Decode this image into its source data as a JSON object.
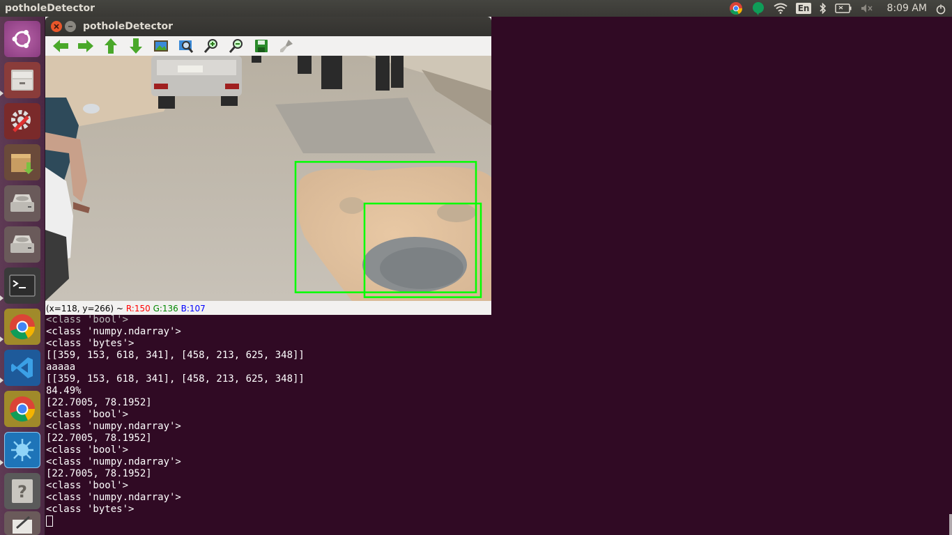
{
  "top_panel": {
    "app_name": "potholeDetector",
    "keyboard_layout": "En",
    "clock": "8:09 AM"
  },
  "window": {
    "title": "potholeDetector",
    "status": {
      "coords": "(x=118, y=266) ~",
      "r": "R:150",
      "g": "G:136",
      "b": "B:107"
    }
  },
  "toolbar_icons": [
    "arrow-left-icon",
    "arrow-right-icon",
    "arrow-up-icon",
    "arrow-down-icon",
    "image-icon",
    "zoom-fit-icon",
    "zoom-in-icon",
    "zoom-out-icon",
    "save-icon",
    "brush-icon"
  ],
  "launcher_icons": [
    "ubuntu-dash-icon",
    "file-manager-icon",
    "system-settings-icon",
    "software-updater-icon",
    "disk-drive-icon",
    "disk-drive-icon",
    "terminal-icon",
    "chrome-icon",
    "vscode-icon",
    "chrome-icon",
    "spyder-icon",
    "help-icon",
    "text-editor-icon"
  ],
  "detections": [
    [
      359,
      153,
      618,
      341
    ],
    [
      458,
      213,
      625,
      348
    ]
  ],
  "terminal": {
    "lines": [
      "<class 'bool'>",
      "<class 'numpy.ndarray'>",
      "<class 'bytes'>",
      "[[359, 153, 618, 341], [458, 213, 625, 348]]",
      "aaaaa",
      "[[359, 153, 618, 341], [458, 213, 625, 348]]",
      "84.49%",
      "[22.7005, 78.1952]",
      "<class 'bool'>",
      "<class 'numpy.ndarray'>",
      "[22.7005, 78.1952]",
      "<class 'bool'>",
      "<class 'numpy.ndarray'>",
      "[22.7005, 78.1952]",
      "<class 'bool'>",
      "<class 'numpy.ndarray'>",
      "<class 'bytes'>"
    ]
  },
  "colors": {
    "desktop_bg": "#300a24",
    "detection_box": "#00ff00",
    "status_r": "#ff0000",
    "status_g": "#008800",
    "status_b": "#0000ff"
  }
}
